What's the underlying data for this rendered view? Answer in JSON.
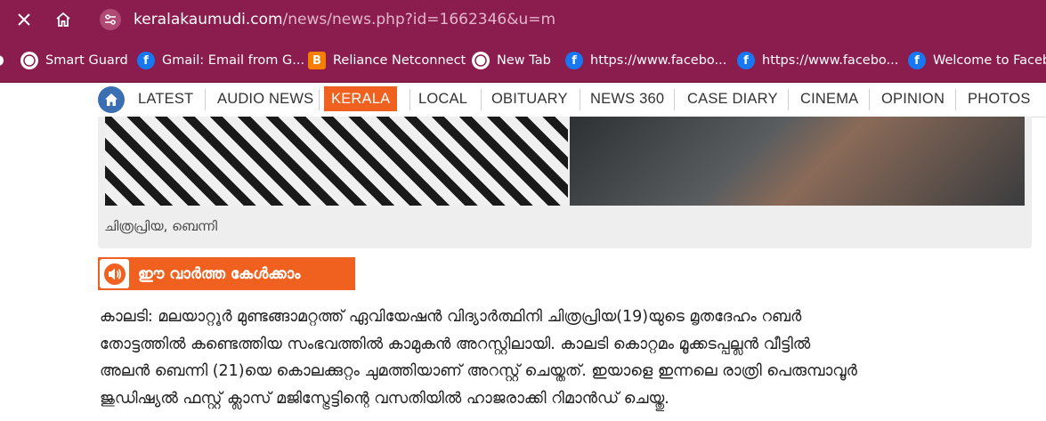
{
  "browser": {
    "url_host": "keralakaumudi.com",
    "url_path": "/news/news.php?id=1662346&u=m",
    "bookmarks": [
      {
        "label": "Smart Guard",
        "icon": "globe-icon"
      },
      {
        "label": "Gmail: Email from G...",
        "icon": "facebook-icon"
      },
      {
        "label": "Reliance Netconnect",
        "icon": "blogger-icon"
      },
      {
        "label": "New Tab",
        "icon": "globe-icon"
      },
      {
        "label": "https://www.facebo...",
        "icon": "facebook-icon"
      },
      {
        "label": "https://www.facebo...",
        "icon": "facebook-icon"
      },
      {
        "label": "Welcome to Facebo",
        "icon": "facebook-icon"
      }
    ],
    "theme_color": "#8a1c4e"
  },
  "nav": {
    "items": [
      "LATEST",
      "AUDIO NEWS",
      "KERALA",
      "LOCAL",
      "OBITUARY",
      "NEWS 360",
      "CASE DIARY",
      "CINEMA",
      "OPINION",
      "PHOTOS"
    ],
    "active": "KERALA",
    "accent": "#f0601e"
  },
  "photo": {
    "caption": "ചിത്രപ്രിയ, ബെന്നി"
  },
  "listen": {
    "label": "ഈ വാർത്ത കേൾക്കാം"
  },
  "article": {
    "lines": [
      "കാലടി: മലയാറ്റൂർ മുണ്ടങ്ങാമറ്റത്ത് ഏവിയേഷൻ വിദ്യാർത്ഥിനി ചിത്രപ്രിയ(19)യുടെ മൃതദേഹം റബർ",
      "തോട്ടത്തിൽ കണ്ടെത്തിയ സംഭവത്തിൽ കാമുകൻ അറസ്റ്റിലായി. കാലടി കൊറ്റമം മൂക്കടപ്പല്ലൻ വീട്ടിൽ",
      "അലൻ ബെന്നി (21)യെ കൊലക്കുറ്റം ചുമത്തിയാണ് അറസ്റ്റ് ചെയ്തത്. ഇയാളെ ഇന്നലെ രാത്രി പെരുമ്പാവൂർ",
      "ജുഡിഷ്യൽ ഫസ്റ്റ് ക്ലാസ് മജിസ്ട്രേട്ടിന്റെ വസതിയിൽ ഹാജരാക്കി റിമാൻഡ് ചെയ്തു."
    ]
  }
}
